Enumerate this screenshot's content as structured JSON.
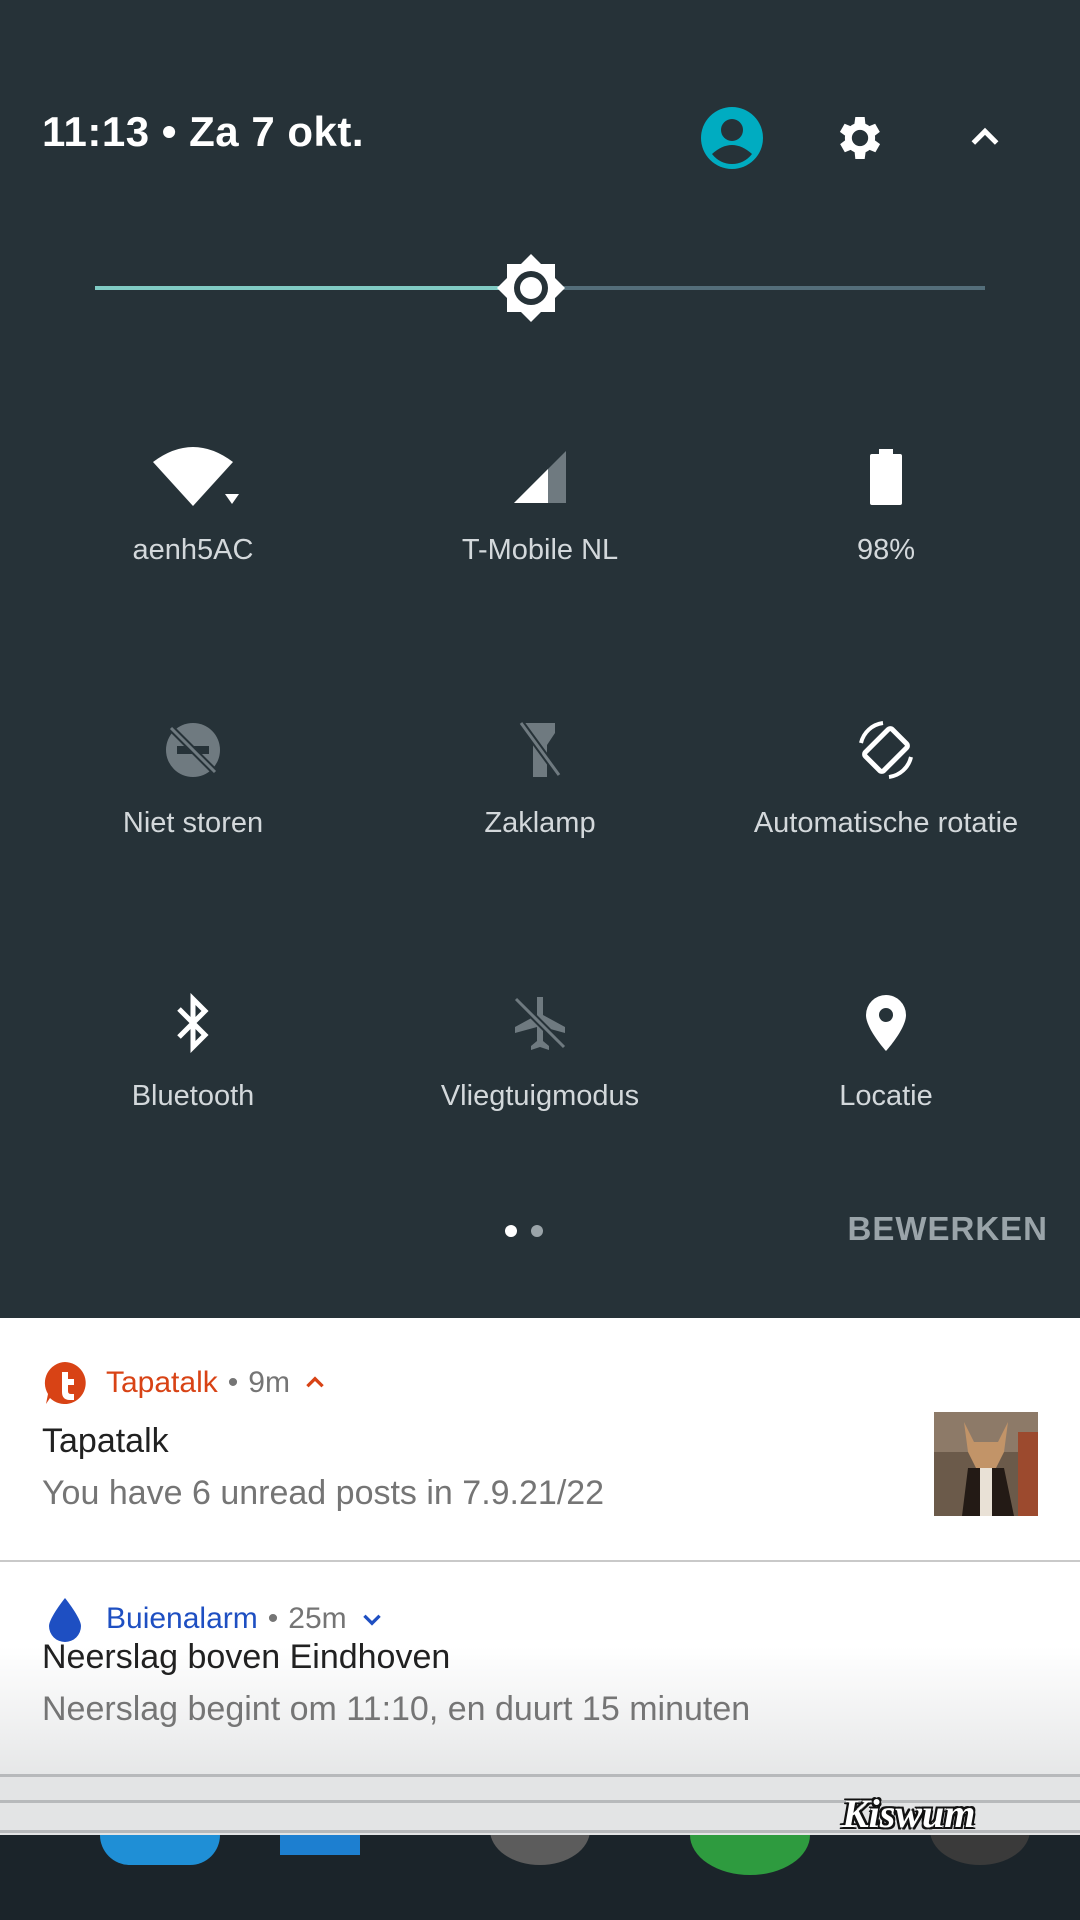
{
  "status_header": {
    "time_date": "11:13 • Za 7 okt.",
    "icons": [
      "user-account-icon",
      "settings-gear-icon",
      "collapse-chevron-up-icon"
    ]
  },
  "brightness": {
    "level_fraction": 0.49,
    "icon": "brightness-sun-icon"
  },
  "tiles": [
    {
      "label": "aenh5AC",
      "icon": "wifi-icon",
      "active": true
    },
    {
      "label": "T-Mobile  NL",
      "icon": "cellular-signal-icon",
      "active": true
    },
    {
      "label": "98%",
      "icon": "battery-icon",
      "active": true
    },
    {
      "label": "Niet storen",
      "icon": "do-not-disturb-off-icon",
      "active": false
    },
    {
      "label": "Zaklamp",
      "icon": "flashlight-off-icon",
      "active": false
    },
    {
      "label": "Automatische rotatie",
      "icon": "auto-rotate-icon",
      "active": true
    },
    {
      "label": "Bluetooth",
      "icon": "bluetooth-icon",
      "active": true
    },
    {
      "label": "Vliegtuigmodus",
      "icon": "airplane-off-icon",
      "active": false
    },
    {
      "label": "Locatie",
      "icon": "location-pin-icon",
      "active": true
    }
  ],
  "pager": {
    "pages": 2,
    "current": 1
  },
  "edit_label": "BEWERKEN",
  "notifications": [
    {
      "app": "Tapatalk",
      "time": "9m",
      "title": "Tapatalk",
      "text": "You have 6 unread posts in 7.9.21/22",
      "accent": "#d84315",
      "expanded": true
    },
    {
      "app": "Buienalarm",
      "time": "25m",
      "title": "Neerslag boven Eindhoven",
      "text": "Neerslag begint om 11:10, en duurt 15 minuten",
      "accent": "#1e4fc2",
      "expanded": false
    }
  ],
  "watermark": "Kiswum",
  "colors": {
    "panel_bg": "#263238",
    "accent_teal": "#80cbc4",
    "avatar_cyan": "#00acc1"
  }
}
